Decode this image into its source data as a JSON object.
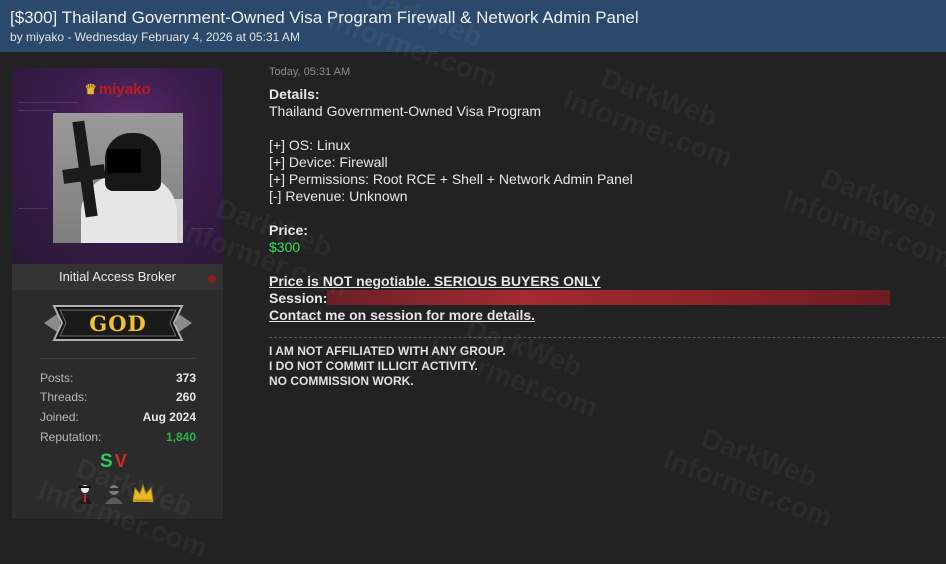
{
  "thread": {
    "title": "[$300] Thailand Government-Owned Visa Program Firewall & Network Admin Panel",
    "meta": "by miyako - Wednesday February 4, 2026 at 05:31 AM"
  },
  "user": {
    "name": "miyako",
    "title": "Initial Access Broker",
    "rank": "GOD",
    "stats": [
      {
        "label": "Posts:",
        "value": "373"
      },
      {
        "label": "Threads:",
        "value": "260"
      },
      {
        "label": "Joined:",
        "value": "Aug 2024"
      },
      {
        "label": "Reputation:",
        "value": "1,840"
      }
    ],
    "rep_badge": {
      "s": "S",
      "v": "V"
    },
    "colors": {
      "username": "#c21a1a",
      "reputation": "#2bb24a",
      "crown": "#e8b923"
    }
  },
  "post": {
    "date": "Today, 05:31 AM",
    "details_label": "Details:",
    "target": "Thailand Government-Owned Visa Program",
    "specs": [
      "[+] OS: Linux",
      "[+] Device: Firewall",
      "[+] Permissions: Root RCE + Shell + Network Admin Panel",
      "[-] Revenue: Unknown"
    ],
    "price_label": "Price:",
    "price_value": "$300",
    "price_color": "#33e05c",
    "negotiable_note": "Price is NOT negotiable. SERIOUS BUYERS ONLY",
    "session_label": "Session:",
    "contact_note": "Contact me on session for more details.",
    "signature": [
      "I AM NOT AFFILIATED WITH ANY GROUP.",
      "I DO NOT COMMIT ILLICIT ACTIVITY.",
      "NO COMMISSION WORK."
    ]
  },
  "watermark": {
    "line1": "DarkWeb",
    "line2": "Informer.com"
  },
  "icons": [
    "crown-icon",
    "status-dot-icon",
    "rank-badge-icon",
    "spy-award-icon",
    "hacker-award-icon",
    "crown-award-icon"
  ]
}
